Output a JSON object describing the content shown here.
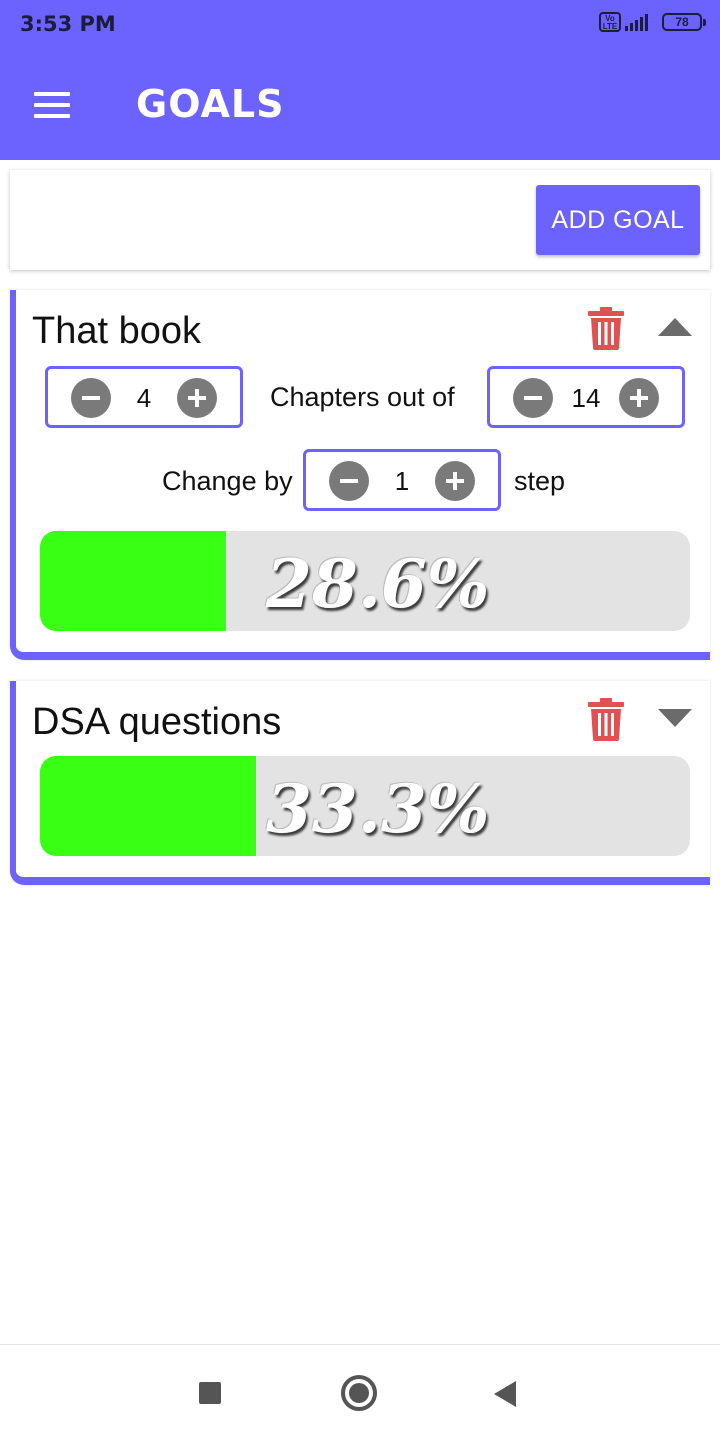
{
  "status_bar": {
    "time": "3:53 PM",
    "volte": "Vo LTE",
    "battery": "78"
  },
  "app_bar": {
    "title": "GOALS",
    "menu_icon": "hamburger-menu-icon"
  },
  "add_goal": {
    "button_label": "ADD GOAL"
  },
  "goals": [
    {
      "title": "That book",
      "expanded": true,
      "current": "4",
      "unit_label": "Chapters out of",
      "total": "14",
      "change_label": "Change by",
      "step_value": "1",
      "step_label": "step",
      "progress_text": "28.6%",
      "progress_fraction": 0.286
    },
    {
      "title": "DSA questions",
      "expanded": false,
      "progress_text": "33.3%",
      "progress_fraction": 0.333
    }
  ],
  "colors": {
    "accent": "#6c63ff",
    "progress_fill": "#39ff14",
    "delete": "#e05252"
  }
}
